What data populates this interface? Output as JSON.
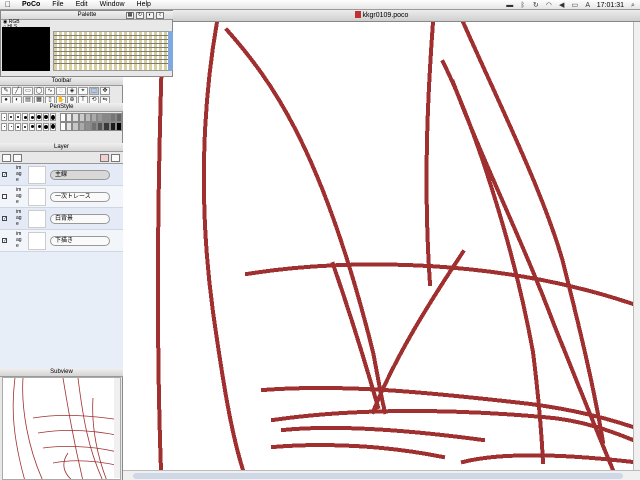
{
  "menubar": {
    "app_name": "PoCo",
    "menus": [
      "File",
      "Edit",
      "Window",
      "Help"
    ],
    "clock": "17:01:31"
  },
  "document": {
    "title": "kkgr0109.poco"
  },
  "palette": {
    "title": "Palette",
    "modes": [
      "RGB",
      "HLS"
    ]
  },
  "toolbar": {
    "title": "Toolbar"
  },
  "penstyle": {
    "title": "PenStyle"
  },
  "layer": {
    "title": "Layer",
    "rows": [
      {
        "type": "image",
        "name": "主線",
        "visible": true,
        "selected": true
      },
      {
        "type": "image",
        "name": "一次トレース",
        "visible": false,
        "selected": false
      },
      {
        "type": "image",
        "name": "白背景",
        "visible": true,
        "selected": false
      },
      {
        "type": "image",
        "name": "下描き",
        "visible": true,
        "selected": false
      }
    ]
  },
  "subview": {
    "title": "Subview"
  },
  "colors": {
    "stroke": "#a03030",
    "selection": "#b8c8e0"
  }
}
